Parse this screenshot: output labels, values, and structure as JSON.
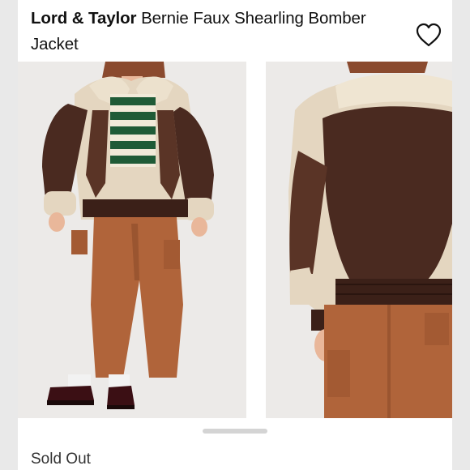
{
  "listing": {
    "brand": "Lord & Taylor",
    "title_rest": "Bernie Faux Shearling Bomber Jacket",
    "status": "Sold Out"
  },
  "icons": {
    "like": "heart-outline-icon"
  },
  "colors": {
    "text": "#111111",
    "muted_text": "#333333",
    "photo_bg": "#eceae8",
    "leather": "#4a2a20",
    "shearling": "#e4d6c0",
    "pants": "#b0643a"
  }
}
